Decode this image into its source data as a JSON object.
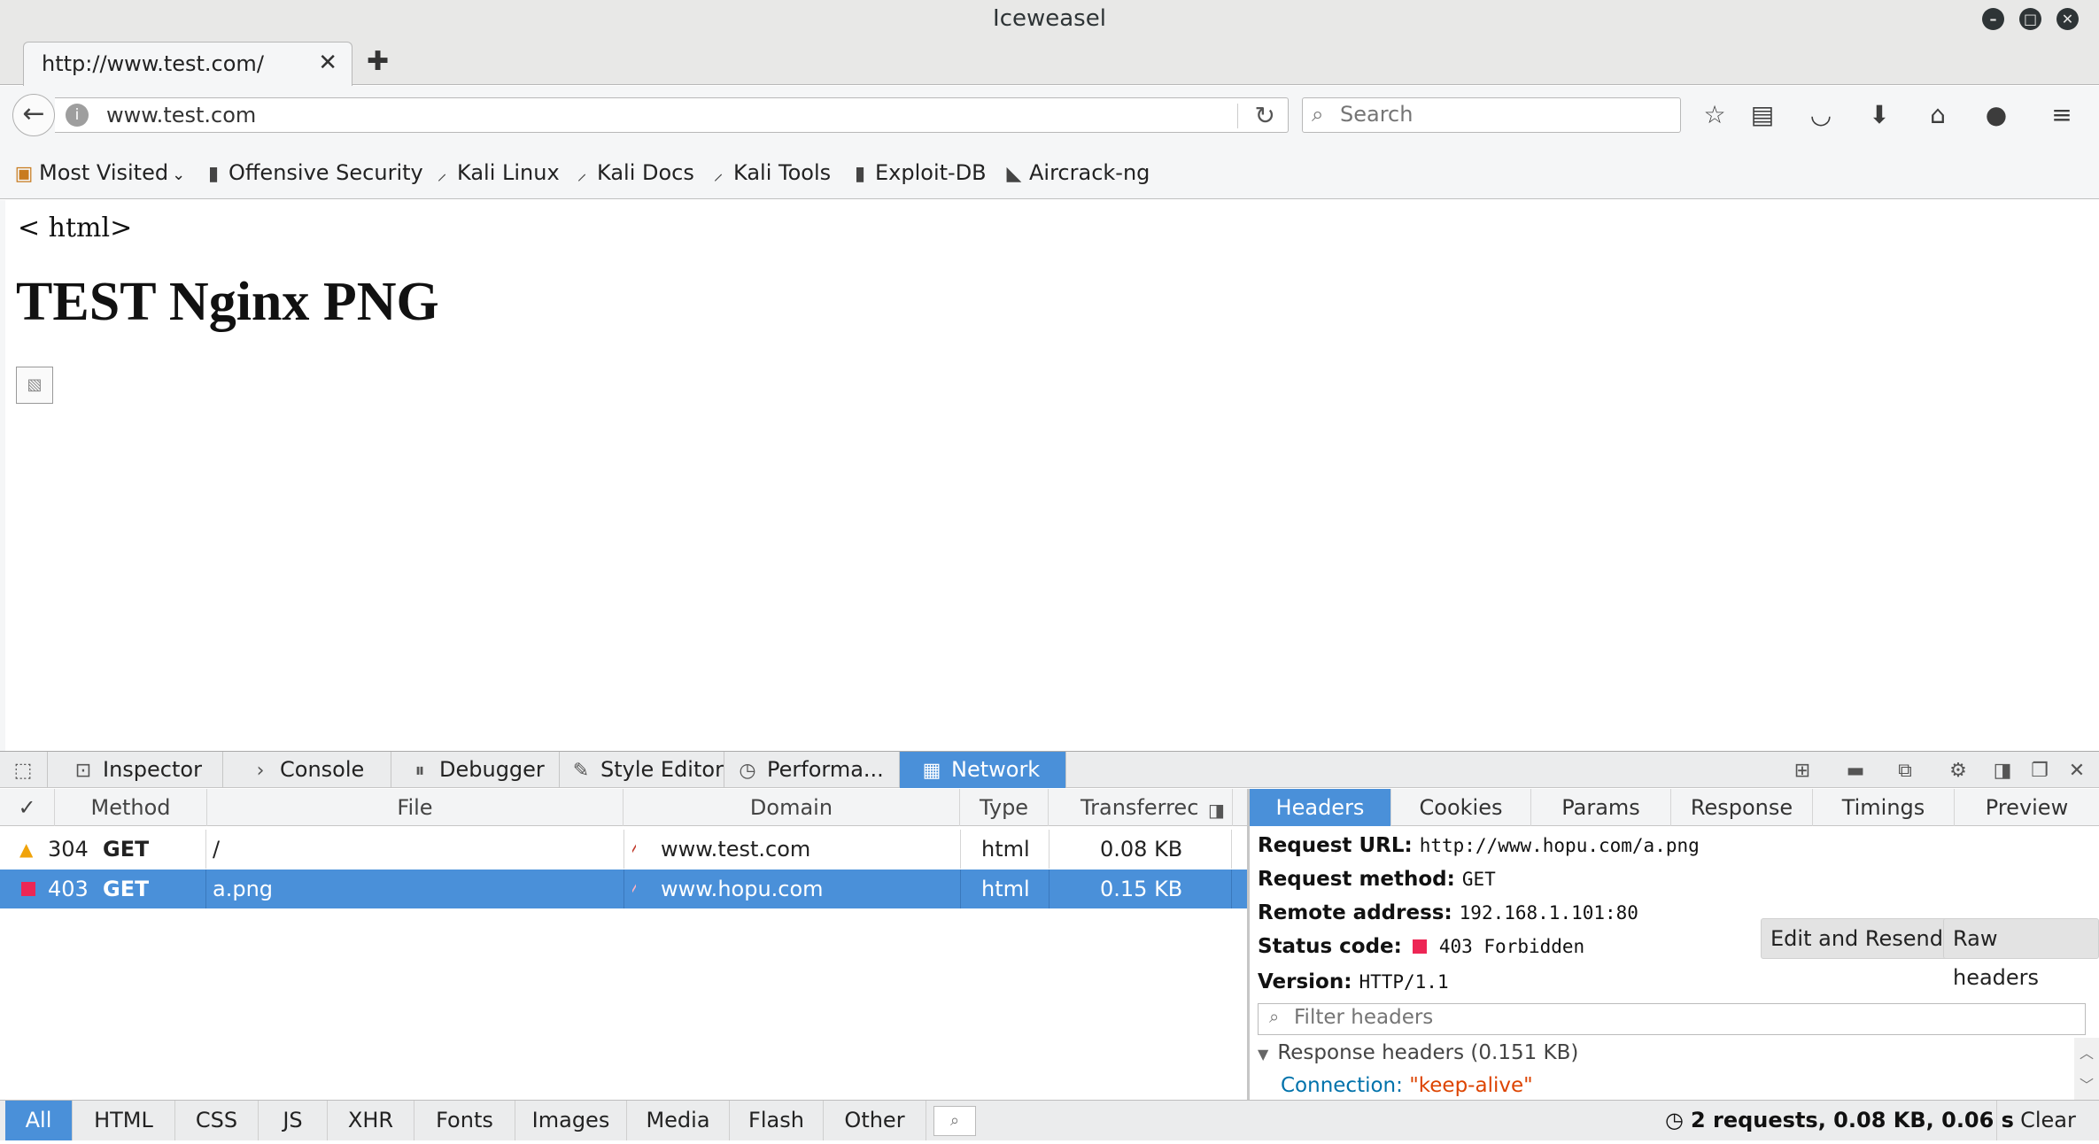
{
  "window": {
    "title": "Iceweasel"
  },
  "tab": {
    "title": "http://www.test.com/",
    "close": "✕",
    "new_tab": "✚"
  },
  "navbar": {
    "url": "www.test.com",
    "search_placeholder": "Search"
  },
  "bookmarks": [
    {
      "label": "Most Visited",
      "icon": "folder-icon"
    },
    {
      "label": "Offensive Security",
      "icon": "offsec-icon"
    },
    {
      "label": "Kali Linux",
      "icon": "kali-dragon-icon"
    },
    {
      "label": "Kali Docs",
      "icon": "kali-dragon-icon"
    },
    {
      "label": "Kali Tools",
      "icon": "kali-dragon-icon"
    },
    {
      "label": "Exploit-DB",
      "icon": "exploitdb-icon"
    },
    {
      "label": "Aircrack-ng",
      "icon": "aircrack-icon"
    }
  ],
  "page": {
    "html_text": "< html>",
    "heading": "TEST Nginx PNG"
  },
  "devtools": {
    "tabs": [
      "Inspector",
      "Console",
      "Debugger",
      "Style Editor",
      "Performa...",
      "Network"
    ],
    "columns": [
      "✓",
      "Method",
      "File",
      "Domain",
      "Type",
      "Transferrec"
    ],
    "requests": [
      {
        "status": "304",
        "method": "GET",
        "file": "/",
        "domain": "www.test.com",
        "type": "html",
        "size": "0.08 KB",
        "status_color": "#f0a30a"
      },
      {
        "status": "403",
        "method": "GET",
        "file": "a.png",
        "domain": "www.hopu.com",
        "type": "html",
        "size": "0.15 KB",
        "status_color": "#ed2655"
      }
    ],
    "detail_tabs": [
      "Headers",
      "Cookies",
      "Params",
      "Response",
      "Timings",
      "Preview"
    ],
    "details": {
      "request_url_label": "Request URL:",
      "request_url": "http://www.hopu.com/a.png",
      "request_method_label": "Request method:",
      "request_method": "GET",
      "remote_address_label": "Remote address:",
      "remote_address": "192.168.1.101:80",
      "status_code_label": "Status code:",
      "status_code": "403 Forbidden",
      "version_label": "Version:",
      "version": "HTTP/1.1",
      "edit_resend": "Edit and Resend",
      "raw_headers": "Raw headers",
      "filter_placeholder": "Filter headers",
      "response_headers": "Response headers (0.151 KB)",
      "connection_key": "Connection:",
      "connection_value": "\"keep-alive\""
    },
    "filters": [
      "All",
      "HTML",
      "CSS",
      "JS",
      "XHR",
      "Fonts",
      "Images",
      "Media",
      "Flash",
      "Other"
    ],
    "summary": "2 requests, 0.08 KB, 0.06 s",
    "clear": "Clear"
  },
  "colors": {
    "accent": "#4a90d9",
    "error": "#ed2655",
    "warning": "#f0a30a",
    "key": "#0072ab",
    "string": "#dd4400"
  }
}
